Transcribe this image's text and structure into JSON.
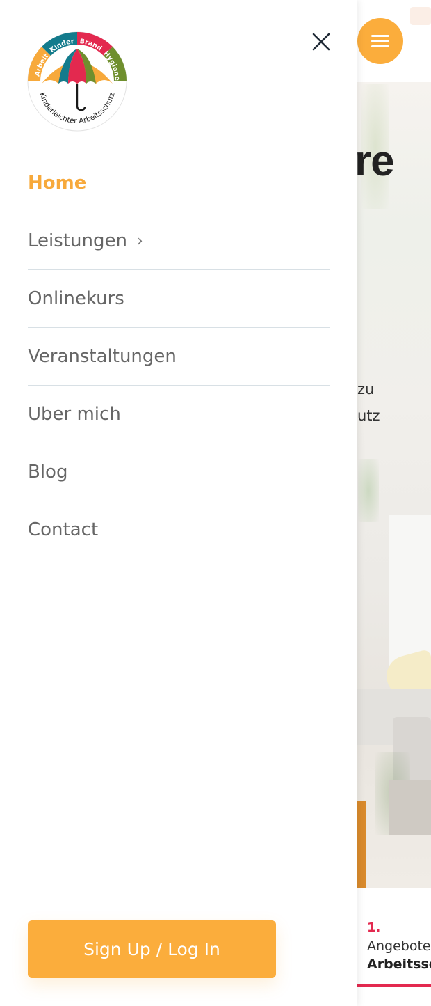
{
  "drawer": {
    "brand": {
      "logo_text_top": [
        "Arbeit",
        "Kinder",
        "Brand",
        "Hygiene"
      ],
      "logo_text_bottom": "Kinderleichter Arbeitsschutz"
    },
    "menu_items": [
      {
        "label": "Home",
        "active": true
      },
      {
        "label": "Leistungen",
        "has_submenu": true,
        "chevron": "›"
      },
      {
        "label": "Onlinekurs"
      },
      {
        "label": "Veranstaltungen"
      },
      {
        "label": "Uber mich"
      },
      {
        "label": "Blog"
      },
      {
        "label": "Contact"
      }
    ],
    "signup_button": "Sign Up / Log In"
  },
  "background_page": {
    "heading_fragment": "re",
    "text_fragments": [
      "zu",
      "utz"
    ],
    "card": {
      "number": "1.",
      "subtitle": "Angebote",
      "title": "Arbeitssc"
    }
  },
  "colors": {
    "accent": "#fbad3c",
    "active_menu": "#f7a93b",
    "menu_text": "#666666",
    "divider": "#d8e0e5",
    "card_accent": "#e3294f"
  },
  "icons": {
    "close": "close-icon",
    "menu": "hamburger-menu-icon",
    "chevron": "chevron-right-icon"
  }
}
